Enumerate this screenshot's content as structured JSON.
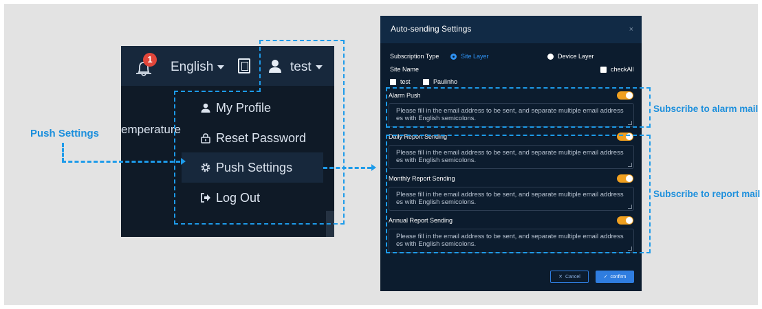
{
  "annotations": {
    "push_settings": "Push Settings",
    "alarm_mail": "Subscribe to alarm mail",
    "report_mail": "Subscribe to report mail"
  },
  "topbar": {
    "notification_count": "1",
    "language": "English",
    "username": "test",
    "partial_text": "emperature"
  },
  "user_menu": {
    "items": [
      {
        "label": "My Profile",
        "icon": "user-icon"
      },
      {
        "label": "Reset Password",
        "icon": "lock-icon"
      },
      {
        "label": "Push Settings",
        "icon": "gear-icon",
        "active": true
      },
      {
        "label": "Log Out",
        "icon": "logout-icon"
      }
    ]
  },
  "dialog": {
    "title": "Auto-sending Settings",
    "close": "×",
    "subscription_type_label": "Subscription Type",
    "option_site": "Site Layer",
    "option_device": "Device Layer",
    "selected_option": "Site Layer",
    "site_name_label": "Site Name",
    "check_all": "checkAll",
    "sites": [
      "test",
      "Paulinho"
    ],
    "sections": [
      {
        "label": "Alarm Push",
        "enabled": true
      },
      {
        "label": "Daily Report Sending",
        "enabled": true
      },
      {
        "label": "Monthly Report Sending",
        "enabled": true
      },
      {
        "label": "Annual Report Sending",
        "enabled": true
      }
    ],
    "email_placeholder_line1": "Please fill in the email address to be sent, and separate multiple email address",
    "email_placeholder_line2": "es with English semicolons.",
    "cancel": "Cancel",
    "confirm": "confirm"
  },
  "colors": {
    "annotation": "#1d9bea",
    "toggle_on": "#f0a020",
    "primary_button": "#2f7de0",
    "badge": "#e2463a"
  }
}
